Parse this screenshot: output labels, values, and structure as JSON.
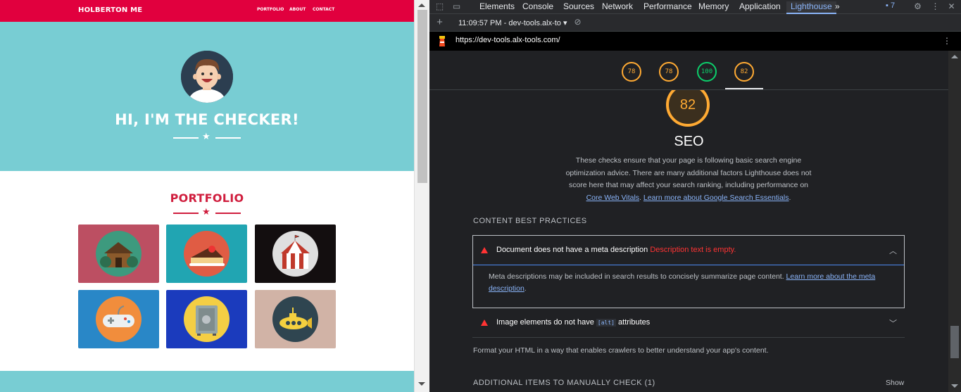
{
  "site": {
    "brand": "HOLBERTON ME",
    "nav": [
      "PORTFOLIO",
      "ABOUT",
      "CONTACT"
    ],
    "hero_title": "HI, I'M THE CHECKER!",
    "portfolio_title": "PORTFOLIO",
    "tiles": [
      {
        "name": "cabin-tile",
        "bg": "#bc4f62",
        "disc": "#3d9a7e"
      },
      {
        "name": "cake-tile",
        "bg": "#21a5b2",
        "disc": "#e05c44"
      },
      {
        "name": "circus-tile",
        "bg": "#130e0f",
        "disc": "#dfdfdf"
      },
      {
        "name": "gamepad-tile",
        "bg": "#2987c7",
        "disc": "#f18d3c"
      },
      {
        "name": "safe-tile",
        "bg": "#1b3bbd",
        "disc": "#f4ce44"
      },
      {
        "name": "submarine-tile",
        "bg": "#d1b3a6",
        "disc": "#2f4550"
      }
    ]
  },
  "devtools": {
    "tabs": [
      "Elements",
      "Console",
      "Sources",
      "Network",
      "Performance",
      "Memory",
      "Application",
      "Lighthouse"
    ],
    "active_tab": "Lighthouse",
    "more_tabs": "»",
    "issues_count": "7",
    "report_time": "11:09:57 PM - dev-tools.alx-to",
    "report_url": "https://dev-tools.alx-tools.com/",
    "gauges": [
      "78",
      "78",
      "100",
      "82"
    ],
    "category_score": "82",
    "category_title": "SEO",
    "category_desc": "These checks ensure that your page is following basic search engine optimization advice. There are many additional factors Lighthouse does not score here that may affect your search ranking, including performance on ",
    "link_core_web_vitals": "Core Web Vitals",
    "link_search_essentials": "Learn more about Google Search Essentials",
    "section_best_practices": "CONTENT BEST PRACTICES",
    "audit_meta_title": "Document does not have a meta description",
    "audit_meta_error": "Description text is empty.",
    "audit_meta_body": "Meta descriptions may be included in search results to concisely summarize page content. ",
    "audit_meta_link": "Learn more about the meta description",
    "audit_img_prefix": "Image elements do not have",
    "audit_img_code": "[alt]",
    "audit_img_suffix": "attributes",
    "format_note": "Format your HTML in a way that enables crawlers to better understand your app's content.",
    "section_manual": "ADDITIONAL ITEMS TO MANUALLY CHECK (1)",
    "show_label": "Show",
    "colors": {
      "accent": "#8ab4f8",
      "fail": "#ff3333",
      "average": "#ffaa33",
      "pass": "#0cce6b"
    }
  }
}
